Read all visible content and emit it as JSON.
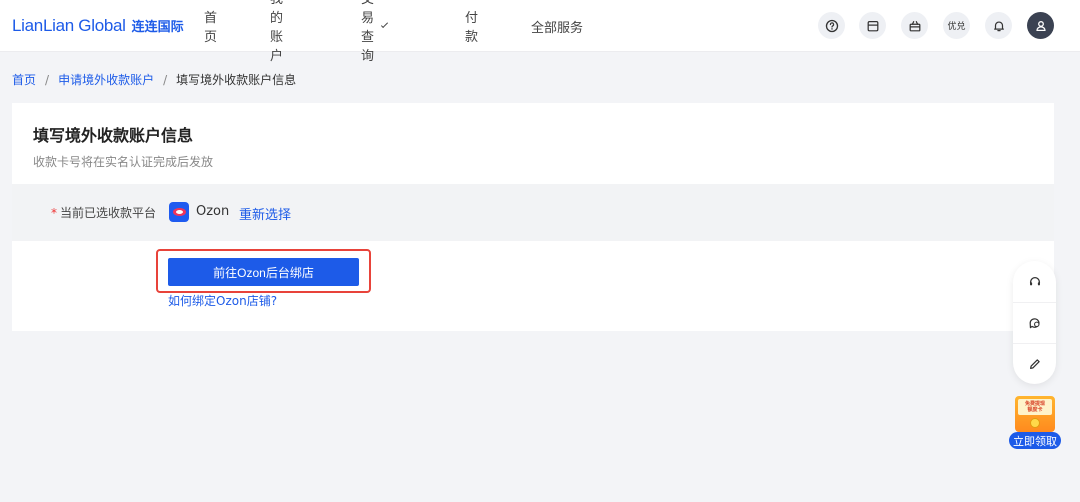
{
  "brand": {
    "name_en": "LianLian Global",
    "name_cn": "连连国际"
  },
  "nav": {
    "home": "首页",
    "my_account": "我的账户",
    "transactions": "交易查询",
    "payment": "付款",
    "all_services": "全部服务"
  },
  "top_icons": {
    "help": "help-icon",
    "calendar": "calendar-icon",
    "gift": "gift-icon",
    "coupon_label": "优兑",
    "bell": "bell-icon",
    "avatar": "user-icon"
  },
  "breadcrumb": {
    "home": "首页",
    "apply": "申请境外收款账户",
    "current": "填写境外收款账户信息"
  },
  "card": {
    "title": "填写境外收款账户信息",
    "subtitle": "收款卡号将在实名认证完成后发放",
    "platform_label": "当前已选收款平台",
    "required_mark": "*",
    "platform_name": "Ozon",
    "reselect": "重新选择",
    "bind_button": "前往Ozon后台绑店",
    "help_link": "如何绑定Ozon店铺?"
  },
  "float_bar": {
    "support": "headset-icon",
    "chat": "chat-icon",
    "edit": "pencil-icon"
  },
  "promo": {
    "line1": "免费提现",
    "line2": "额度卡",
    "cta": "立即领取"
  },
  "colors": {
    "brand": "#1d5be8",
    "highlight": "#e8433a",
    "required": "#ee3333"
  }
}
